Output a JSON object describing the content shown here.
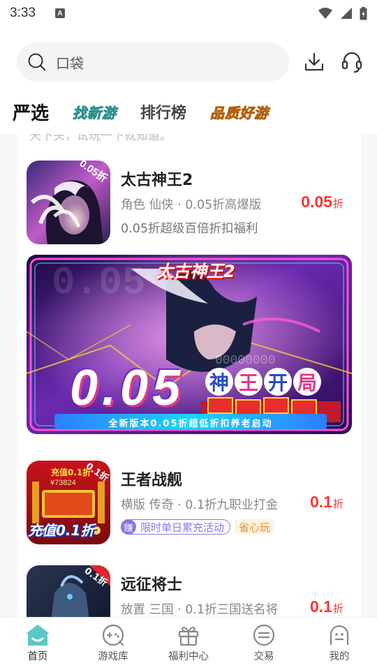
{
  "status": {
    "time": "3:33",
    "notif_letter": "A"
  },
  "search": {
    "text": "口袋"
  },
  "tabs": [
    "严选",
    "找新游",
    "排行榜",
    "品质好游"
  ],
  "feed": {
    "cut_text": "天下头，试玩一下就知道。",
    "games": [
      {
        "name": "太古神王2",
        "meta": "角色 仙侠 · 0.05折高爆版",
        "welfare": "0.05折超级百倍折扣福利",
        "discount": "0.05",
        "unit": "折",
        "icon_text": "0.05折"
      },
      {
        "name": "王者战舰",
        "meta": "横版 传奇 · 0.1折九职业打金",
        "tag1_icon": "赚",
        "tag1": "限时单日累充活动",
        "tag2": "省心玩",
        "discount": "0.1",
        "unit": "折",
        "icon_text_top": "充值0.1折",
        "icon_amount": "¥73824",
        "icon_text_bottom": "充值0.1折",
        "icon_corner": "0.1折"
      },
      {
        "name": "远征将士",
        "meta": "放置 三国 · 0.1折三国送名将",
        "discount": "0.1",
        "unit": "折",
        "icon_corner": "0.1折"
      }
    ],
    "banner": {
      "logo": "太古神王2",
      "big": "0.05",
      "slogan_chars": [
        "神",
        "王",
        "开",
        "局"
      ],
      "strip": "全新版本0.05折超低折扣养老启动",
      "bg_digits": "0.05",
      "bg_digits2": "00000000"
    }
  },
  "tabbar": [
    {
      "label": "首页",
      "icon": "home-icon",
      "active": true
    },
    {
      "label": "游戏库",
      "icon": "gamepad-icon",
      "active": false
    },
    {
      "label": "福利中心",
      "icon": "gift-icon",
      "active": false
    },
    {
      "label": "交易",
      "icon": "trade-icon",
      "active": false
    },
    {
      "label": "我的",
      "icon": "profile-icon",
      "active": false
    }
  ],
  "colors": {
    "accent": "#5bc8c4",
    "price": "#ff3333",
    "purple": "#8a78e8"
  }
}
